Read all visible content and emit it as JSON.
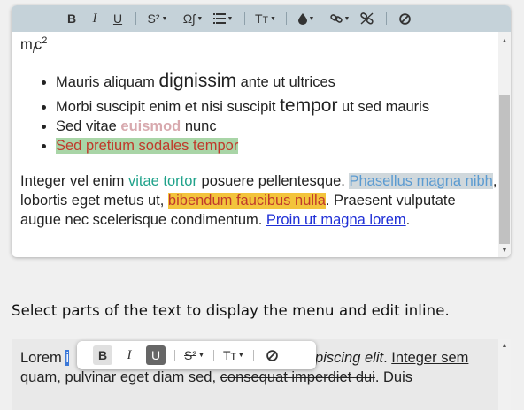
{
  "toolbar": {
    "bold": "B",
    "italic": "I",
    "underline": "U",
    "script": "S²",
    "special": "Ωʃ",
    "size": "Tт"
  },
  "content": {
    "top_fragment_base": "m",
    "top_fragment_sub": "l",
    "top_fragment_c": "c",
    "top_fragment_sup": "2",
    "list": {
      "item1_a": "Mauris aliquam ",
      "item1_big": "dignissim",
      "item1_b": " ante ut ultrices",
      "item2_a": "Morbi suscipit enim et nisi suscipit ",
      "item2_big": "tempor",
      "item2_b": " ut sed mauris",
      "item3_a": "Sed vitae ",
      "item3_pink": "euismod",
      "item3_b": " nunc",
      "item4": "Sed pretium sodales tempor"
    },
    "para": {
      "a": "Integer vel enim ",
      "teal": "vitae tortor",
      "b": " posuere pellentesque. ",
      "blue": "Phasellus magna nibh",
      "c": ", lobortis eget metus ut, ",
      "yellow": "bibendum faucibus nulla",
      "d": ". Praesent vulputate augue nec scelerisque condimentum. ",
      "link": "Proin ut magna lorem",
      "e": "."
    }
  },
  "instructions": "Select parts of the text to display the menu and edit inline.",
  "editor2": {
    "a": "Lorem ",
    "selected": "i",
    "italic": "adipiscing elit",
    "b": ". ",
    "ul1": "Integer sem quam",
    "c": ", ",
    "ul2": "pulvinar eget diam sed",
    "d": ", ",
    "strike": "consequat imperdiet dui",
    "e": ". Duis"
  },
  "popup": {
    "bold": "B",
    "italic": "I",
    "underline": "U",
    "script": "S²",
    "size": "Tт"
  },
  "colors": {
    "toolbar_bg": "#c5d2d9",
    "teal": "#1fa28a",
    "yellow_highlight": "#f3c43c",
    "green_highlight": "#a9d5a7",
    "link": "#1f2fd6"
  }
}
